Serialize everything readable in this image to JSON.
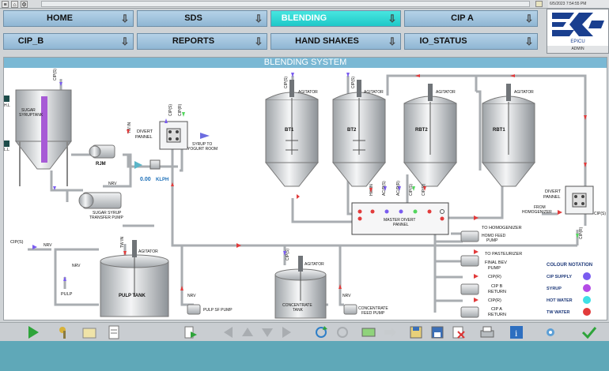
{
  "window": {
    "datetime": "6/5/2023 7:54:55 PM"
  },
  "nav": {
    "home": "HOME",
    "sds": "SDS",
    "blending": "BLENDING",
    "cip_a": "CIP A",
    "cip_b": "CIP_B",
    "reports": "REPORTS",
    "hand_shakes": "HAND SHAKES",
    "io_status": "IO_STATUS",
    "arrow_icon": "down-arrow-icon"
  },
  "logo": {
    "text": "EPICU",
    "user": "ADMIN",
    "brand_color": "#1a3f8f"
  },
  "panel": {
    "title": "BLENDING SYSTEM"
  },
  "diagram": {
    "sugar_tank": "SUGAR\nSYRUPTANK",
    "hl": "H.L",
    "ll": "L.L",
    "cips": "CIP(S)",
    "cipr": "CIP(R)",
    "twin": "TW IN",
    "rjm": "RJM",
    "nrv": "NRV",
    "flow_value": "0.00",
    "flow_unit": "KLPH",
    "transfer_pump": "SUGAR SYRUP\nTRANSFER PUMP",
    "divert_panel": "DIVERT\nPANNEL",
    "syrup_to_yogurt": "SYRUP TO\nYOGURT ROOM",
    "agitator": "AGITATOR",
    "bt1": "BT1",
    "bt2": "BT2",
    "rbt2": "RBT2",
    "rbt1": "RBT1",
    "master_divert": "MASTER DIVERT\nPANNEL",
    "hw_in": "HW IN",
    "ac_p_s": "AC(P(S)",
    "ac_p_r": "AC(P(R)",
    "cip_s2": "CIP(S)",
    "cip_r2": "CIP(R)",
    "from_homogenizer": "FROM\nHOMOGENIZER",
    "to_homogenizer": "TO HOMOGENIZER",
    "homo_feed": "HOMO FEED\nPUMP",
    "to_pasteurizer": "TO PASTEURIZER",
    "final_bev": "FINAL BEV\nPUMP",
    "cip_b_return": "CIP B\nRETURN",
    "cip_a_return": "CIP A\nRETURN",
    "pulp": "PULP",
    "pulp_tank": "PULP TANK",
    "pulp_sf_pump": "PULP SF PUMP",
    "concentrate_tank": "CONCENTRATE\nTANK",
    "concentrate_feed": "CONCENTRATE\nFEED PUMP",
    "nrv2": "NRV"
  },
  "legend": {
    "title": "COLOUR NOTATION",
    "items": [
      {
        "label": "CIP SUPPLY",
        "color": "#7a5cf0"
      },
      {
        "label": "SYRUP",
        "color": "#b44be6"
      },
      {
        "label": "HOT WATER",
        "color": "#3ee0e6"
      },
      {
        "label": "TW WATER",
        "color": "#e23b3b"
      }
    ]
  },
  "toolbar": {
    "icons": [
      "play-icon",
      "key-icon",
      "folder-icon",
      "document-icon",
      "export-icon",
      "back-icon",
      "up-icon",
      "down-icon",
      "forward-icon",
      "refresh-icon",
      "redo-icon",
      "image-icon",
      "arrow-right-icon",
      "save-icon",
      "save-as-icon",
      "delete-icon",
      "print-icon",
      "info-icon",
      "help-icon",
      "settings-icon",
      "checkmark-icon"
    ]
  }
}
